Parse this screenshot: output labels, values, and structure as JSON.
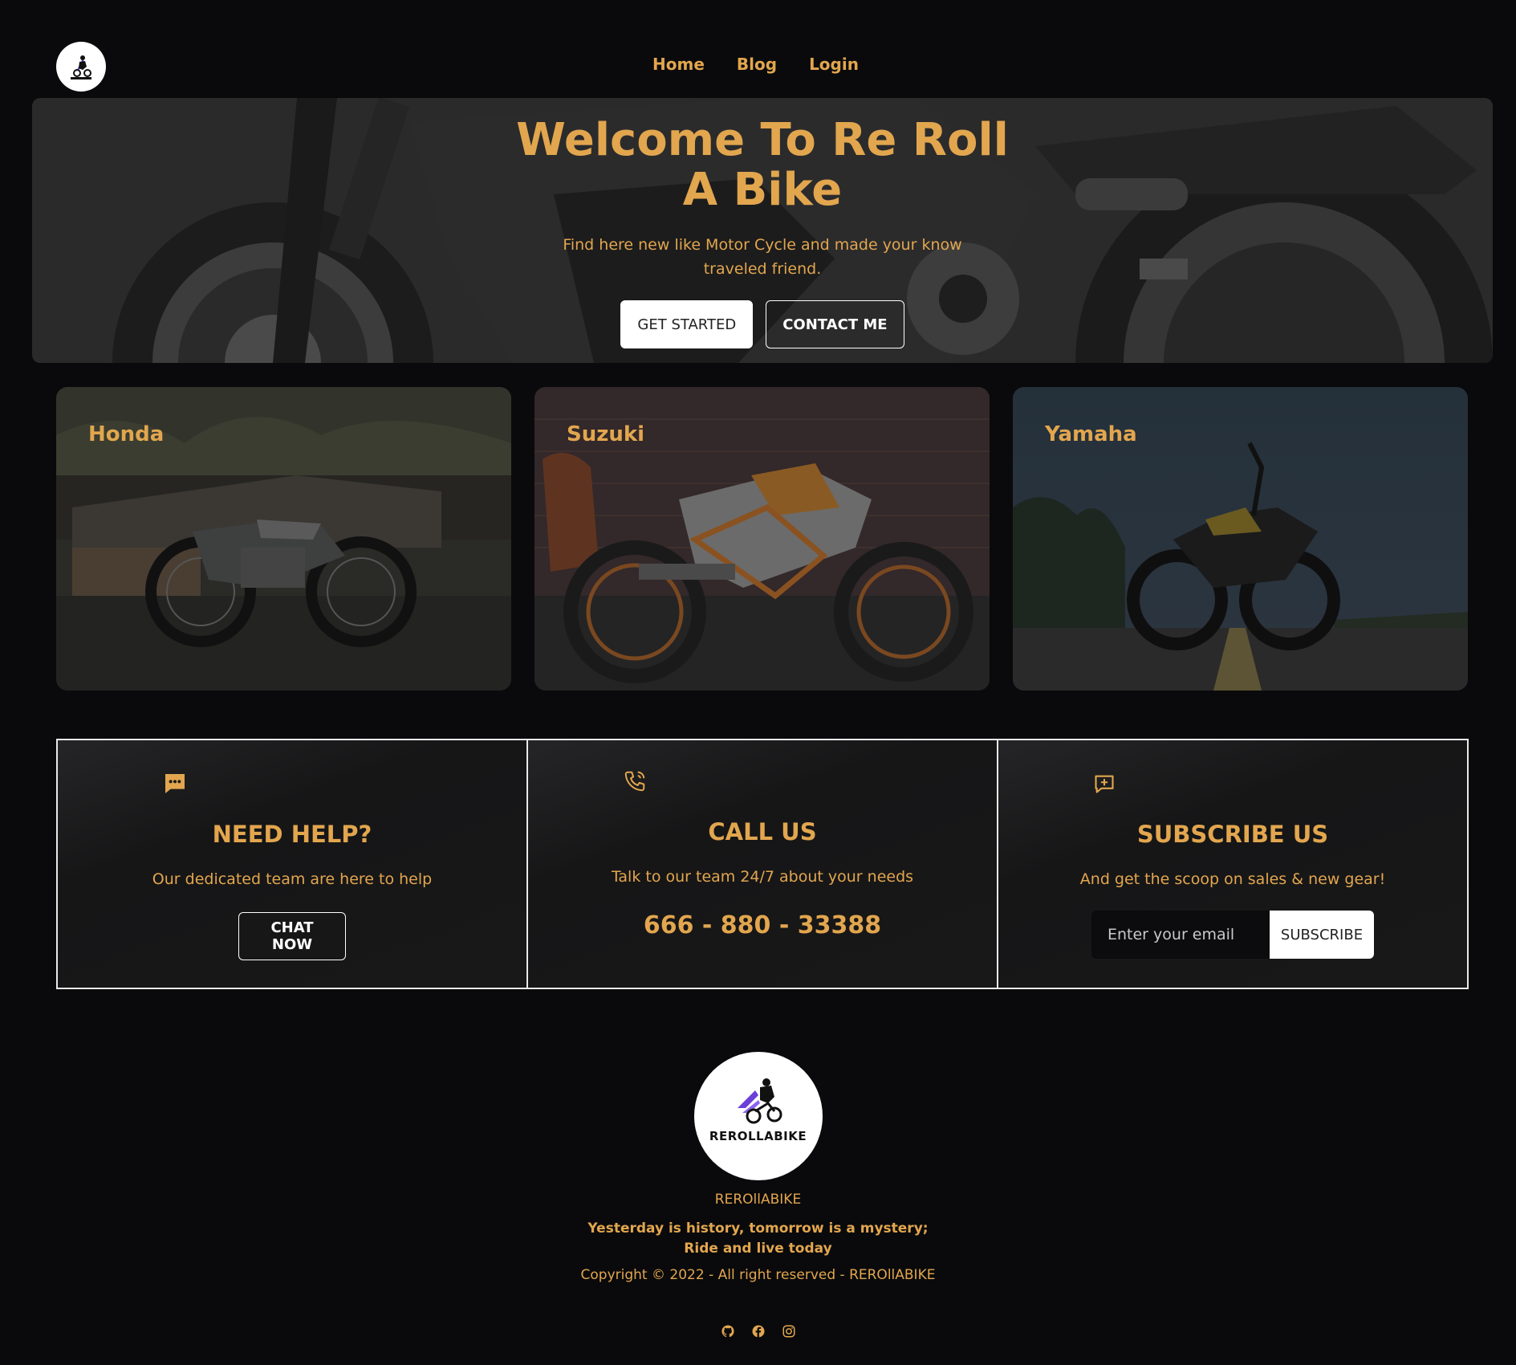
{
  "nav": {
    "logo_alt": "REROLLABIKE",
    "links": [
      "Home",
      "Blog",
      "Login"
    ]
  },
  "hero": {
    "title": "Welcome To Re Roll A Bike",
    "subtitle": "Find here new like Motor Cycle and made your know traveled friend.",
    "primary_button": "GET STARTED",
    "secondary_button": "CONTACT ME"
  },
  "brands": [
    {
      "label": "Honda"
    },
    {
      "label": "Suzuki"
    },
    {
      "label": "Yamaha"
    }
  ],
  "help": {
    "icon": "chat-bubble-icon",
    "title": "NEED HELP?",
    "text": "Our dedicated team are here to help",
    "button": "CHAT NOW"
  },
  "call": {
    "icon": "phone-icon",
    "title": "CALL US",
    "text": "Talk to our team 24/7 about your needs",
    "phone": "666 - 880 - 33388"
  },
  "subscribe": {
    "icon": "message-plus-icon",
    "title": "SUBSCRIBE US",
    "text": "And get the scoop on sales & new gear!",
    "placeholder": "Enter your email",
    "button": "SUBSCRIBE"
  },
  "footer": {
    "logo_text": "REROLLABIKE",
    "brand": "REROllABIKE",
    "motto_line1": "Yesterday is history, tomorrow is a mystery;",
    "motto_line2": "Ride and live today",
    "copyright": "Copyright © 2022 - All right reserved - REROllABIKE",
    "socials": [
      "github-icon",
      "facebook-icon",
      "instagram-icon"
    ]
  },
  "colors": {
    "background": "#0a0a0c",
    "accent": "#e2a64e",
    "box_border": "#e9e9e9"
  }
}
